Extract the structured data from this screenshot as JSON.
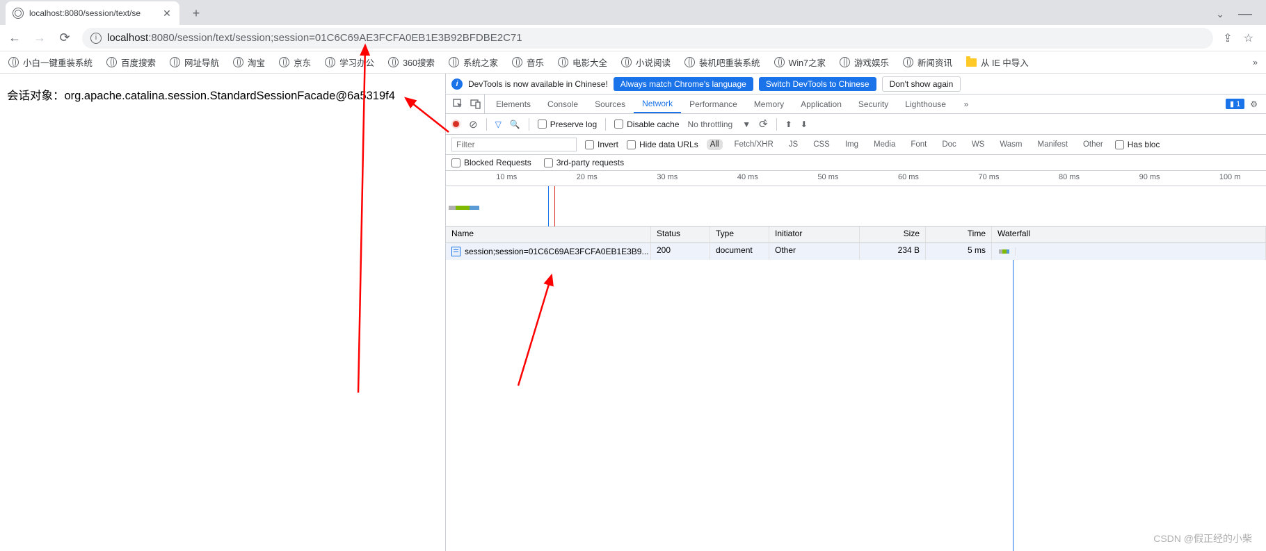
{
  "browser": {
    "tab_title": "localhost:8080/session/text/se",
    "url_host": "localhost",
    "url_path": ":8080/session/text/session;session=01C6C69AE3FCFA0EB1E3B92BFDBE2C71",
    "bookmarks": [
      "小白一键重装系统",
      "百度搜索",
      "网址导航",
      "淘宝",
      "京东",
      "学习办公",
      "360搜索",
      "系统之家",
      "音乐",
      "电影大全",
      "小说阅读",
      "装机吧重装系统",
      "Win7之家",
      "游戏娱乐",
      "新闻资讯"
    ],
    "bookmark_folder": "从 IE 中导入"
  },
  "page": {
    "body_text": "会话对象：org.apache.catalina.session.StandardSessionFacade@6a5319f4"
  },
  "devtools": {
    "infobar": {
      "message": "DevTools is now available in Chinese!",
      "btn_match": "Always match Chrome's language",
      "btn_switch": "Switch DevTools to Chinese",
      "btn_dont": "Don't show again"
    },
    "tabs": [
      "Elements",
      "Console",
      "Sources",
      "Network",
      "Performance",
      "Memory",
      "Application",
      "Security",
      "Lighthouse"
    ],
    "active_tab": "Network",
    "issues_count": "1",
    "toolbar": {
      "preserve_log": "Preserve log",
      "disable_cache": "Disable cache",
      "throttling": "No throttling"
    },
    "filter": {
      "placeholder": "Filter",
      "invert": "Invert",
      "hide_data_urls": "Hide data URLs",
      "types": [
        "All",
        "Fetch/XHR",
        "JS",
        "CSS",
        "Img",
        "Media",
        "Font",
        "Doc",
        "WS",
        "Wasm",
        "Manifest",
        "Other"
      ],
      "active_type": "All",
      "has_blocked": "Has bloc",
      "blocked_requests": "Blocked Requests",
      "third_party": "3rd-party requests"
    },
    "timeline_ticks": [
      "10 ms",
      "20 ms",
      "30 ms",
      "40 ms",
      "50 ms",
      "60 ms",
      "70 ms",
      "80 ms",
      "90 ms",
      "100 m"
    ],
    "table": {
      "headers": {
        "name": "Name",
        "status": "Status",
        "type": "Type",
        "initiator": "Initiator",
        "size": "Size",
        "time": "Time",
        "waterfall": "Waterfall"
      },
      "rows": [
        {
          "name": "session;session=01C6C69AE3FCFA0EB1E3B9...",
          "status": "200",
          "type": "document",
          "initiator": "Other",
          "size": "234 B",
          "time": "5 ms"
        }
      ]
    }
  },
  "watermark": "CSDN @假正经的小柴"
}
